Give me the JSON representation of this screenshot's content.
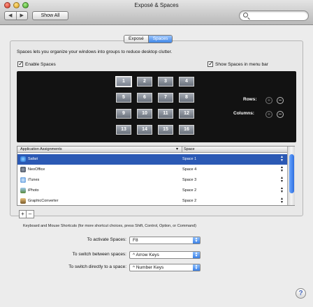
{
  "window": {
    "title": "Exposé & Spaces"
  },
  "toolbar": {
    "back_label": "◀",
    "forward_label": "▶",
    "show_all_label": "Show All",
    "search_placeholder": ""
  },
  "tabs": [
    {
      "label": "Exposé",
      "active": false
    },
    {
      "label": "Spaces",
      "active": true
    }
  ],
  "description": "Spaces lets you organize your windows into groups to reduce desktop clutter.",
  "enable_spaces": {
    "label": "Enable Spaces",
    "checked": true
  },
  "show_in_menu_bar": {
    "label": "Show Spaces in menu bar",
    "checked": true
  },
  "space_tiles": [
    "1",
    "2",
    "3",
    "4",
    "5",
    "6",
    "7",
    "8",
    "9",
    "10",
    "11",
    "12",
    "13",
    "14",
    "15",
    "16"
  ],
  "selected_tile": "1",
  "rows_label": "Rows:",
  "columns_label": "Columns:",
  "table": {
    "col_app": "Application Assignments",
    "col_space": "Space",
    "rows": [
      {
        "app": "Safari",
        "space": "Space 1",
        "selected": true
      },
      {
        "app": "NeoOffice",
        "space": "Space 4",
        "selected": false
      },
      {
        "app": "iTunes",
        "space": "Space 3",
        "selected": false
      },
      {
        "app": "iPhoto",
        "space": "Space 2",
        "selected": false
      },
      {
        "app": "GraphicConverter",
        "space": "Space 2",
        "selected": false
      }
    ]
  },
  "add_label": "+",
  "remove_label": "–",
  "shortcut_note": "Keyboard and Mouse Shortcuts (for more shortcut choices, press Shift, Control, Option, or Command)",
  "activate": {
    "label": "To activate Spaces:",
    "value": "F8"
  },
  "switch_between": {
    "label": "To switch between spaces:",
    "value": "^ Arrow Keys"
  },
  "switch_directly": {
    "label": "To switch directly to a space:",
    "value": "^ Number Keys"
  },
  "help_label": "?"
}
